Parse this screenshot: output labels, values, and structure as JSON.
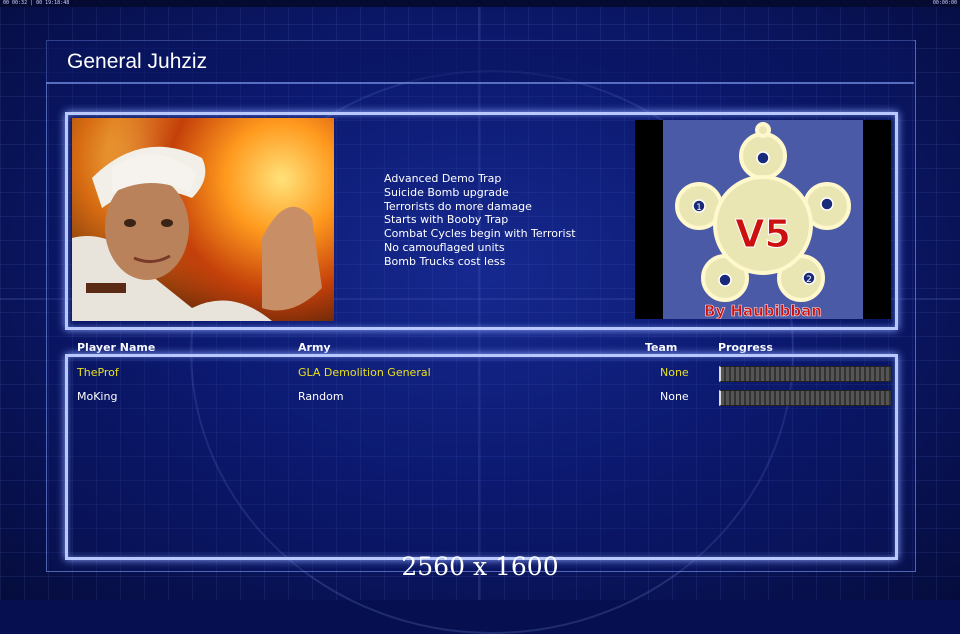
{
  "general": {
    "name": "General Juhziz"
  },
  "features": [
    "Advanced Demo Trap",
    "Suicide Bomb upgrade",
    "Terrorists do more damage",
    "Starts with Booby Trap",
    "Combat Cycles begin with Terrorist",
    "No camouflaged units",
    "Bomb Trucks cost less"
  ],
  "map": {
    "title": "V5",
    "credit": "By Haubibban",
    "start_labels": [
      "1",
      "2"
    ]
  },
  "table": {
    "headers": {
      "player": "Player Name",
      "army": "Army",
      "team": "Team",
      "progress": "Progress"
    },
    "rows": [
      {
        "player": "TheProf",
        "army": "GLA Demolition General",
        "team": "None",
        "progress": 0,
        "color": "#e8e020"
      },
      {
        "player": "MoKing",
        "army": "Random",
        "team": "None",
        "progress": 0,
        "color": "#ffffff"
      }
    ]
  },
  "resolution": "2560 x 1600",
  "topbar": {
    "left": "00 00:32 | 00 19:18:48",
    "right": "00:00:00"
  },
  "colors": {
    "background": "#0c1a70",
    "border": "#b9c8ff",
    "highlight_text": "#e8e020"
  }
}
